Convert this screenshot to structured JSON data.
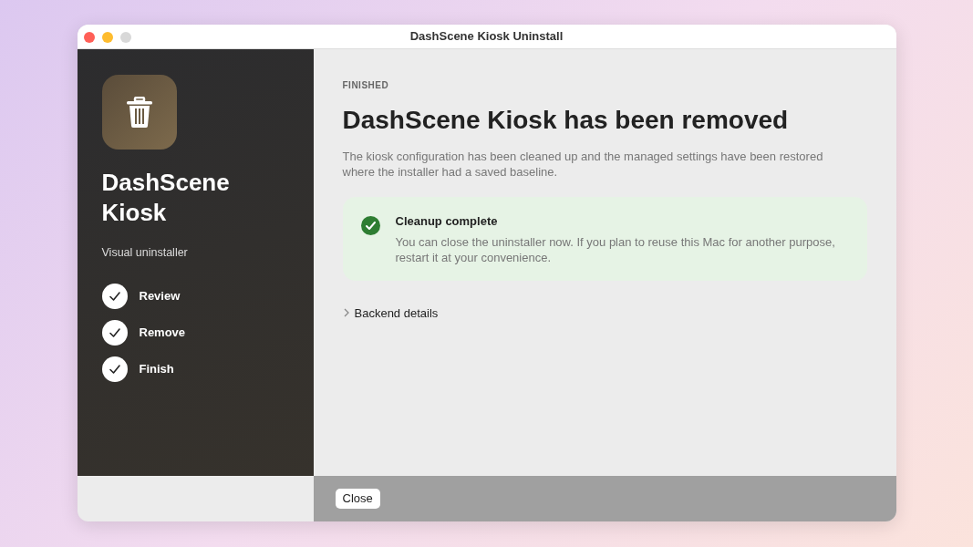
{
  "window": {
    "title": "DashScene Kiosk Uninstall"
  },
  "sidebar": {
    "app_name": "DashScene Kiosk",
    "subtitle": "Visual uninstaller",
    "steps": [
      {
        "label": "Review",
        "done": true
      },
      {
        "label": "Remove",
        "done": true
      },
      {
        "label": "Finish",
        "done": true
      }
    ]
  },
  "content": {
    "eyebrow": "FINISHED",
    "heading": "DashScene Kiosk has been removed",
    "description": "The kiosk configuration has been cleaned up and the managed settings have been restored where the installer had a saved baseline.",
    "notice": {
      "title": "Cleanup complete",
      "body": "You can close the uninstaller now. If you plan to reuse this Mac for another purpose, restart it at your convenience."
    },
    "disclosure": {
      "label": "Backend details",
      "expanded": false
    }
  },
  "footer": {
    "buttons": [
      "Close"
    ]
  }
}
